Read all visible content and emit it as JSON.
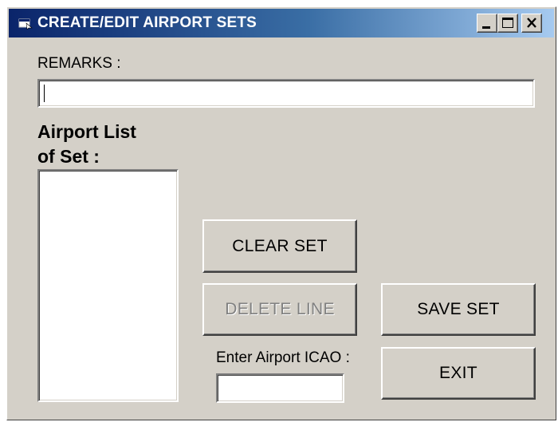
{
  "window": {
    "title": "CREATE/EDIT AIRPORT SETS",
    "title_icon": "app-window-icon",
    "controls": {
      "minimize_icon": "minimize-icon",
      "maximize_icon": "maximize-icon",
      "close_icon": "close-icon"
    }
  },
  "form": {
    "remarks_label": "REMARKS :",
    "remarks_value": "",
    "airport_list_label_line1": "Airport List",
    "airport_list_label_line2": "of Set :",
    "airport_list_items": [],
    "icao_label": "Enter Airport ICAO :",
    "icao_value": ""
  },
  "buttons": {
    "clear_set": "CLEAR SET",
    "delete_line": "DELETE LINE",
    "delete_line_enabled": false,
    "save_set": "SAVE SET",
    "exit": "EXIT"
  },
  "colors": {
    "titlebar_start": "#0a246a",
    "titlebar_end": "#a6caf0",
    "face": "#d4d0c8",
    "disabled_text": "#808080"
  }
}
